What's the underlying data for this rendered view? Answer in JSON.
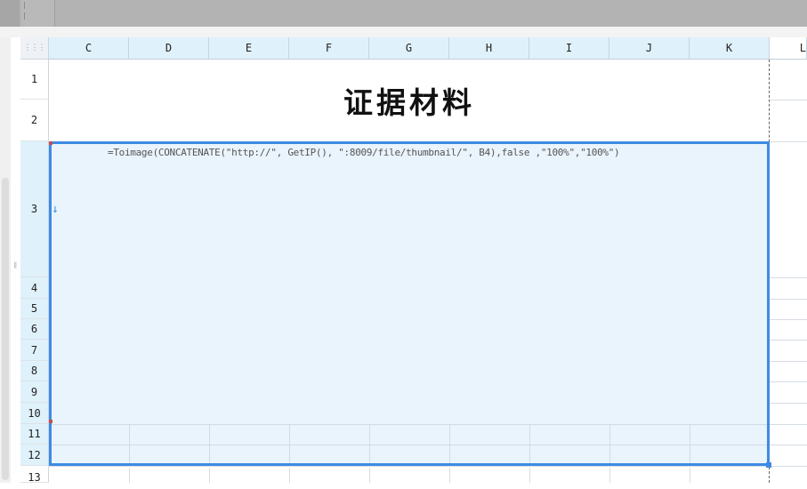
{
  "toolbar": {
    "background": "#b3b3b3"
  },
  "corner_label": "⋮⋮⋮",
  "columns": [
    "C",
    "D",
    "E",
    "F",
    "G",
    "H",
    "I",
    "J",
    "K",
    "L"
  ],
  "rows": [
    "1",
    "2",
    "3",
    "4",
    "5",
    "6",
    "7",
    "8",
    "9",
    "10",
    "11",
    "12",
    "13"
  ],
  "title": "证据材料",
  "formula": "=Toimage(CONCATENATE(\"http://\", GetIP(), \":8009/file/thumbnail/\", B4),false ,\"100%\",\"100%\")",
  "arrow_glyph": "↓",
  "colors": {
    "selection_border": "#3d8be3",
    "selection_fill": "#eaf4fd",
    "header_selected": "#dff1fb"
  }
}
